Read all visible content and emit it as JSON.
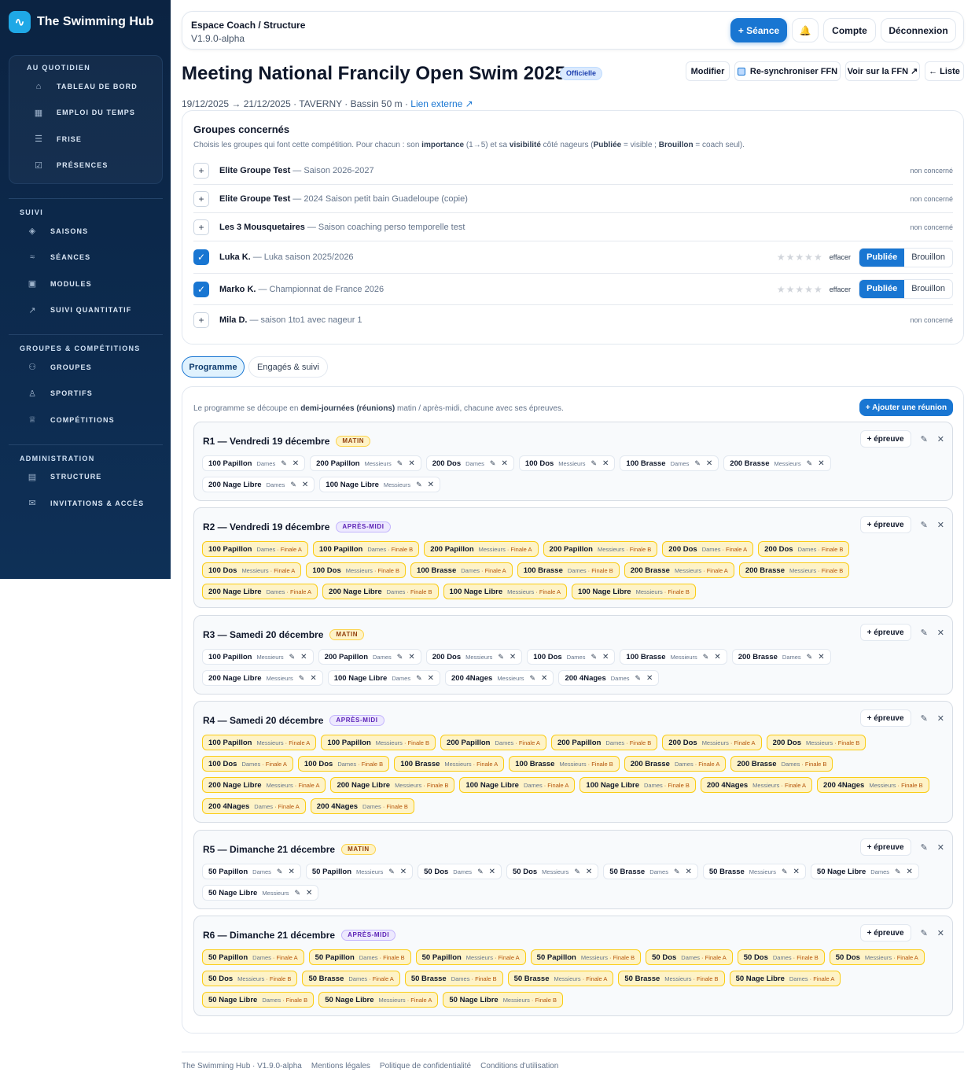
{
  "sidebar": {
    "brand": "The Swimming Hub",
    "brand_icon": "wave-icon",
    "daily": {
      "heading": "AU QUOTIDIEN",
      "items": [
        {
          "label": "TABLEAU DE BORD",
          "icon": "home-icon"
        },
        {
          "label": "EMPLOI DU TEMPS",
          "icon": "calendar-icon"
        },
        {
          "label": "FRISE",
          "icon": "timeline-icon"
        },
        {
          "label": "PRÉSENCES",
          "icon": "clipboard-check-icon"
        }
      ]
    },
    "suivi": {
      "heading": "SUIVI",
      "items": [
        {
          "label": "SAISONS",
          "icon": "layers-icon"
        },
        {
          "label": "SÉANCES",
          "icon": "waves-icon"
        },
        {
          "label": "MODULES",
          "icon": "grid-icon"
        },
        {
          "label": "SUIVI QUANTITATIF",
          "icon": "trend-icon"
        }
      ]
    },
    "groups": {
      "heading": "GROUPES & COMPÉTITIONS",
      "items": [
        {
          "label": "GROUPES",
          "icon": "users-icon"
        },
        {
          "label": "SPORTIFS",
          "icon": "user-icon"
        },
        {
          "label": "COMPÉTITIONS",
          "icon": "trophy-icon"
        }
      ]
    },
    "admin": {
      "heading": "ADMINISTRATION",
      "items": [
        {
          "label": "STRUCTURE",
          "icon": "building-icon"
        },
        {
          "label": "INVITATIONS & ACCÈS",
          "icon": "mail-icon"
        }
      ]
    }
  },
  "topbar": {
    "title": "Espace Coach / Structure",
    "version": "V1.9.0-alpha",
    "seance": "+ Séance",
    "bell": "🔔",
    "compte": "Compte",
    "logout": "Déconnexion"
  },
  "meet": {
    "title": "Meeting National Francily Open Swim 2025",
    "badge": "Officielle",
    "modifier": "Modifier",
    "resync": "Re-synchroniser FFN",
    "ffn": "Voir sur la FFN ↗",
    "liste": "← Liste",
    "meta": "19/12/2025 → 21/12/2025 · TAVERNY · Bassin 50 m · ",
    "link": "Lien externe ↗"
  },
  "groups": {
    "title": "Groupes concernés",
    "sub1": "Choisis les groupes qui font cette compétition. Pour chacun : son ",
    "sub_b1": "importance",
    "sub2": " (1→5) et sa ",
    "sub_b2": "visibilité",
    "sub3": " côté nageurs (",
    "sub_b3": "Publiée",
    "sub4": " = visible ; ",
    "sub_b4": "Brouillon",
    "sub5": " = coach seul).",
    "stars": "★★★★★",
    "effacer": "effacer",
    "pub": "Publiée",
    "draft": "Brouillon",
    "rows": [
      {
        "name": "Elite Groupe Test",
        "season": "— Saison 2026-2027",
        "status": "non concerné",
        "on": false
      },
      {
        "name": "Elite Groupe Test",
        "season": "— 2024 Saison petit bain Guadeloupe (copie)",
        "status": "non concerné",
        "on": false
      },
      {
        "name": "Les 3 Mousquetaires",
        "season": "— Saison coaching perso temporelle test",
        "status": "non concerné",
        "on": false
      },
      {
        "name": "Luka K.",
        "season": "— Luka saison 2025/2026",
        "status": "",
        "on": true
      },
      {
        "name": "Marko K.",
        "season": "— Championnat de France 2026",
        "status": "",
        "on": true
      },
      {
        "name": "Mila D.",
        "season": "— saison 1to1 avec nageur 1",
        "status": "non concerné",
        "on": false
      }
    ]
  },
  "tabs": {
    "programme": "Programme",
    "engages": "Engagés & suivi"
  },
  "program": {
    "intro1": "Le programme se découpe en ",
    "intro_b": "demi-journées (réunions)",
    "intro2": " matin / après-midi, chacune avec ses épreuves.",
    "add": "+ Ajouter une réunion",
    "ep_btn": "+ épreuve",
    "reunions": [
      {
        "title": "R1 — Vendredi 19 décembre",
        "badge": "MATIN",
        "kind": "matin",
        "events": [
          {
            "e": "100 Papillon",
            "s": "Dames"
          },
          {
            "e": "200 Papillon",
            "s": "Messieurs"
          },
          {
            "e": "200 Dos",
            "s": "Dames"
          },
          {
            "e": "100 Dos",
            "s": "Messieurs"
          },
          {
            "e": "100 Brasse",
            "s": "Dames"
          },
          {
            "e": "200 Brasse",
            "s": "Messieurs"
          },
          {
            "e": "200 Nage Libre",
            "s": "Dames"
          },
          {
            "e": "100 Nage Libre",
            "s": "Messieurs"
          }
        ]
      },
      {
        "title": "R2 — Vendredi 19 décembre",
        "badge": "APRÈS-MIDI",
        "kind": "am",
        "events": [
          {
            "e": "100 Papillon",
            "s": "Dames",
            "f": "· Finale A"
          },
          {
            "e": "100 Papillon",
            "s": "Dames",
            "f": "· Finale B"
          },
          {
            "e": "200 Papillon",
            "s": "Messieurs",
            "f": "· Finale A"
          },
          {
            "e": "200 Papillon",
            "s": "Messieurs",
            "f": "· Finale B"
          },
          {
            "e": "200 Dos",
            "s": "Dames",
            "f": "· Finale A"
          },
          {
            "e": "200 Dos",
            "s": "Dames",
            "f": "· Finale B"
          },
          {
            "e": "100 Dos",
            "s": "Messieurs",
            "f": "· Finale A"
          },
          {
            "e": "100 Dos",
            "s": "Messieurs",
            "f": "· Finale B"
          },
          {
            "e": "100 Brasse",
            "s": "Dames",
            "f": "· Finale A"
          },
          {
            "e": "100 Brasse",
            "s": "Dames",
            "f": "· Finale B"
          },
          {
            "e": "200 Brasse",
            "s": "Messieurs",
            "f": "· Finale A"
          },
          {
            "e": "200 Brasse",
            "s": "Messieurs",
            "f": "· Finale B"
          },
          {
            "e": "200 Nage Libre",
            "s": "Dames",
            "f": "· Finale A"
          },
          {
            "e": "200 Nage Libre",
            "s": "Dames",
            "f": "· Finale B"
          },
          {
            "e": "100 Nage Libre",
            "s": "Messieurs",
            "f": "· Finale A"
          },
          {
            "e": "100 Nage Libre",
            "s": "Messieurs",
            "f": "· Finale B"
          }
        ]
      },
      {
        "title": "R3 — Samedi 20 décembre",
        "badge": "MATIN",
        "kind": "matin",
        "events": [
          {
            "e": "100 Papillon",
            "s": "Messieurs"
          },
          {
            "e": "200 Papillon",
            "s": "Dames"
          },
          {
            "e": "200 Dos",
            "s": "Messieurs"
          },
          {
            "e": "100 Dos",
            "s": "Dames"
          },
          {
            "e": "100 Brasse",
            "s": "Messieurs"
          },
          {
            "e": "200 Brasse",
            "s": "Dames"
          },
          {
            "e": "200 Nage Libre",
            "s": "Messieurs"
          },
          {
            "e": "100 Nage Libre",
            "s": "Dames"
          },
          {
            "e": "200 4Nages",
            "s": "Messieurs"
          },
          {
            "e": "200 4Nages",
            "s": "Dames"
          }
        ]
      },
      {
        "title": "R4 — Samedi 20 décembre",
        "badge": "APRÈS-MIDI",
        "kind": "am",
        "events": [
          {
            "e": "100 Papillon",
            "s": "Messieurs",
            "f": "· Finale A"
          },
          {
            "e": "100 Papillon",
            "s": "Messieurs",
            "f": "· Finale B"
          },
          {
            "e": "200 Papillon",
            "s": "Dames",
            "f": "· Finale A"
          },
          {
            "e": "200 Papillon",
            "s": "Dames",
            "f": "· Finale B"
          },
          {
            "e": "200 Dos",
            "s": "Messieurs",
            "f": "· Finale A"
          },
          {
            "e": "200 Dos",
            "s": "Messieurs",
            "f": "· Finale B"
          },
          {
            "e": "100 Dos",
            "s": "Dames",
            "f": "· Finale A"
          },
          {
            "e": "100 Dos",
            "s": "Dames",
            "f": "· Finale B"
          },
          {
            "e": "100 Brasse",
            "s": "Messieurs",
            "f": "· Finale A"
          },
          {
            "e": "100 Brasse",
            "s": "Messieurs",
            "f": "· Finale B"
          },
          {
            "e": "200 Brasse",
            "s": "Dames",
            "f": "· Finale A"
          },
          {
            "e": "200 Brasse",
            "s": "Dames",
            "f": "· Finale B"
          },
          {
            "e": "200 Nage Libre",
            "s": "Messieurs",
            "f": "· Finale A"
          },
          {
            "e": "200 Nage Libre",
            "s": "Messieurs",
            "f": "· Finale B"
          },
          {
            "e": "100 Nage Libre",
            "s": "Dames",
            "f": "· Finale A"
          },
          {
            "e": "100 Nage Libre",
            "s": "Dames",
            "f": "· Finale B"
          },
          {
            "e": "200 4Nages",
            "s": "Messieurs",
            "f": "· Finale A"
          },
          {
            "e": "200 4Nages",
            "s": "Messieurs",
            "f": "· Finale B"
          },
          {
            "e": "200 4Nages",
            "s": "Dames",
            "f": "· Finale A"
          },
          {
            "e": "200 4Nages",
            "s": "Dames",
            "f": "· Finale B"
          }
        ]
      },
      {
        "title": "R5 — Dimanche 21 décembre",
        "badge": "MATIN",
        "kind": "matin",
        "events": [
          {
            "e": "50 Papillon",
            "s": "Dames"
          },
          {
            "e": "50 Papillon",
            "s": "Messieurs"
          },
          {
            "e": "50 Dos",
            "s": "Dames"
          },
          {
            "e": "50 Dos",
            "s": "Messieurs"
          },
          {
            "e": "50 Brasse",
            "s": "Dames"
          },
          {
            "e": "50 Brasse",
            "s": "Messieurs"
          },
          {
            "e": "50 Nage Libre",
            "s": "Dames"
          },
          {
            "e": "50 Nage Libre",
            "s": "Messieurs"
          }
        ]
      },
      {
        "title": "R6 — Dimanche 21 décembre",
        "badge": "APRÈS-MIDI",
        "kind": "am",
        "events": [
          {
            "e": "50 Papillon",
            "s": "Dames",
            "f": "· Finale A"
          },
          {
            "e": "50 Papillon",
            "s": "Dames",
            "f": "· Finale B"
          },
          {
            "e": "50 Papillon",
            "s": "Messieurs",
            "f": "· Finale A"
          },
          {
            "e": "50 Papillon",
            "s": "Messieurs",
            "f": "· Finale B"
          },
          {
            "e": "50 Dos",
            "s": "Dames",
            "f": "· Finale A"
          },
          {
            "e": "50 Dos",
            "s": "Dames",
            "f": "· Finale B"
          },
          {
            "e": "50 Dos",
            "s": "Messieurs",
            "f": "· Finale A"
          },
          {
            "e": "50 Dos",
            "s": "Messieurs",
            "f": "· Finale B"
          },
          {
            "e": "50 Brasse",
            "s": "Dames",
            "f": "· Finale A"
          },
          {
            "e": "50 Brasse",
            "s": "Dames",
            "f": "· Finale B"
          },
          {
            "e": "50 Brasse",
            "s": "Messieurs",
            "f": "· Finale A"
          },
          {
            "e": "50 Brasse",
            "s": "Messieurs",
            "f": "· Finale B"
          },
          {
            "e": "50 Nage Libre",
            "s": "Dames",
            "f": "· Finale A"
          },
          {
            "e": "50 Nage Libre",
            "s": "Dames",
            "f": "· Finale B"
          },
          {
            "e": "50 Nage Libre",
            "s": "Messieurs",
            "f": "· Finale A"
          },
          {
            "e": "50 Nage Libre",
            "s": "Messieurs",
            "f": "· Finale B"
          }
        ]
      }
    ]
  },
  "footer": {
    "version": "The Swimming Hub · V1.9.0-alpha",
    "links": [
      "Mentions légales",
      "Politique de confidentialité",
      "Conditions d'utilisation"
    ]
  },
  "colors": {
    "primary": "#1976d2",
    "sidebar": "#0b2342",
    "final_chip": "#fef3c7"
  }
}
